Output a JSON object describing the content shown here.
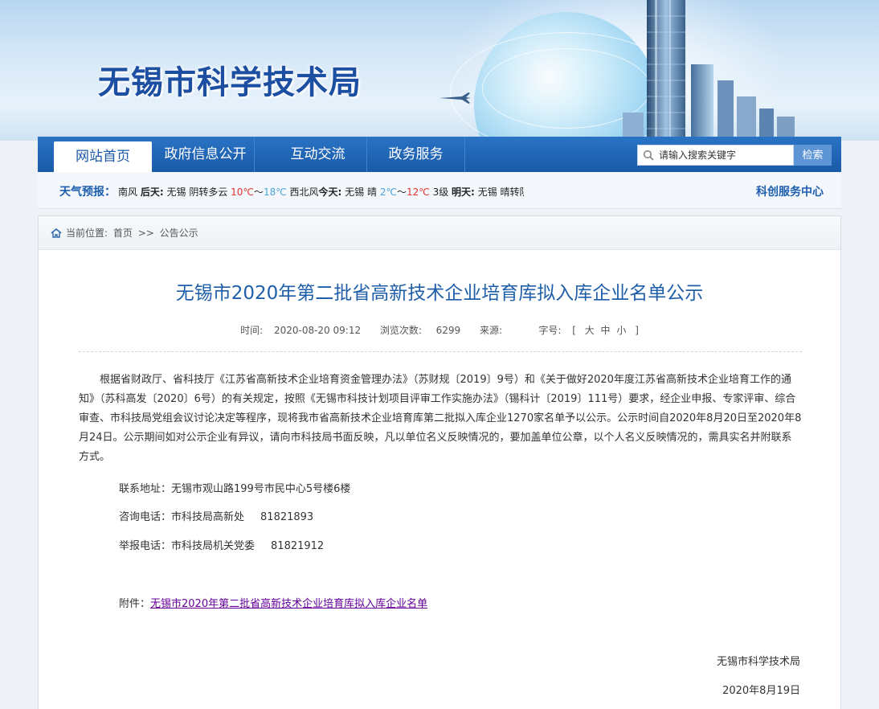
{
  "site": {
    "title": "无锡市科学技术局"
  },
  "nav": {
    "items": [
      {
        "label": "网站首页",
        "active": true
      },
      {
        "label": "政府信息公开",
        "active": false
      },
      {
        "label": "互动交流",
        "active": false
      },
      {
        "label": "政务服务",
        "active": false
      }
    ],
    "search_placeholder": "请输入搜索关键字",
    "search_button": "检索"
  },
  "weather": {
    "label": "天气预报：",
    "lead": "南风",
    "tomorrow_label": "后天:",
    "tomorrow_city": "无锡",
    "tomorrow_cond": "阴转多云",
    "tomorrow_high": "10℃",
    "tomorrow_sep": "～",
    "tomorrow_low": "18℃",
    "tomorrow_wind": "西北风",
    "today_label": "今天:",
    "today_city": "无锡",
    "today_cond": "晴",
    "today_low": "2℃",
    "today_sep": "～",
    "today_high": "12℃",
    "today_level": "3级",
    "next_label": "明天:",
    "next_city": "无锡",
    "next_cond": "晴转阴"
  },
  "service_link": "科创服务中心",
  "breadcrumb": {
    "prefix": "当前位置:",
    "home": "首页",
    "sep": ">>",
    "current": "公告公示"
  },
  "article": {
    "title": "无锡市2020年第二批省高新技术企业培育库拟入库企业名单公示",
    "time_label": "时间:",
    "time": "2020-08-20 09:12",
    "views_label": "浏览次数:",
    "views": "6299",
    "source_label": "来源:",
    "source": "",
    "fontsize_label": "字号:",
    "fontsize_open": "[",
    "fontsize_big": "大",
    "fontsize_mid": "中",
    "fontsize_small": "小",
    "fontsize_close": "]",
    "body": "根据省财政厅、省科技厅《江苏省高新技术企业培育资金管理办法》（苏财规〔2019〕9号）和《关于做好2020年度江苏省高新技术企业培育工作的通知》（苏科高发〔2020〕6号）的有关规定，按照《无锡市科技计划项目评审工作实施办法》（锡科计〔2019〕111号）要求，经企业申报、专家评审、综合审查、市科技局党组会议讨论决定等程序，现将我市省高新技术企业培育库第二批拟入库企业1270家名单予以公示。公示时间自2020年8月20日至2020年8月24日。公示期间如对公示企业有异议，请向市科技局书面反映，凡以单位名义反映情况的，要加盖单位公章，以个人名义反映情况的，需具实名并附联系方式。",
    "address_label": "联系地址：",
    "address": "无锡市观山路199号市民中心5号楼6楼",
    "consult_label": "咨询电话：",
    "consult_dept": "市科技局高新处",
    "consult_phone": "81821893",
    "report_label": "举报电话：",
    "report_dept": "市科技局机关党委",
    "report_phone": "81821912",
    "attach_label": "附件：",
    "attach_link": "无锡市2020年第二批省高新技术企业培育库拟入库企业名单",
    "signer": "无锡市科学技术局",
    "date": "2020年8月19日"
  },
  "colors": {
    "brand_blue": "#1f64b5",
    "title_blue": "#1f5fa9",
    "link_purple": "#660099",
    "temp_red": "#e3322f"
  }
}
